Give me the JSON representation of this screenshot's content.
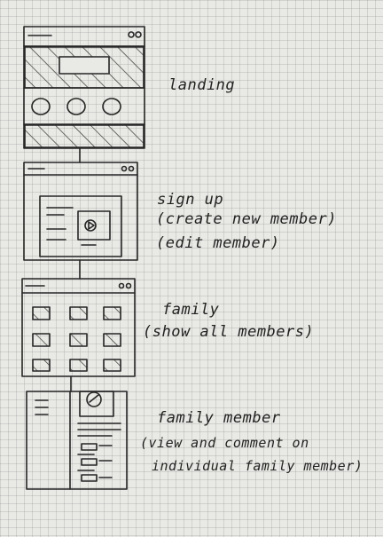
{
  "screens": [
    {
      "name": "landing",
      "labels": [
        "landing"
      ]
    },
    {
      "name": "signup",
      "labels": [
        "sign up",
        "(create new member)",
        "(edit member)"
      ]
    },
    {
      "name": "family",
      "labels": [
        "family",
        "(show all members)"
      ]
    },
    {
      "name": "family-member",
      "labels": [
        "family member",
        "(view and comment on",
        "individual family member)"
      ]
    }
  ],
  "colors": {
    "ink": "#262626",
    "paper": "#e9e9e5",
    "grid": "#b9b9b4"
  }
}
